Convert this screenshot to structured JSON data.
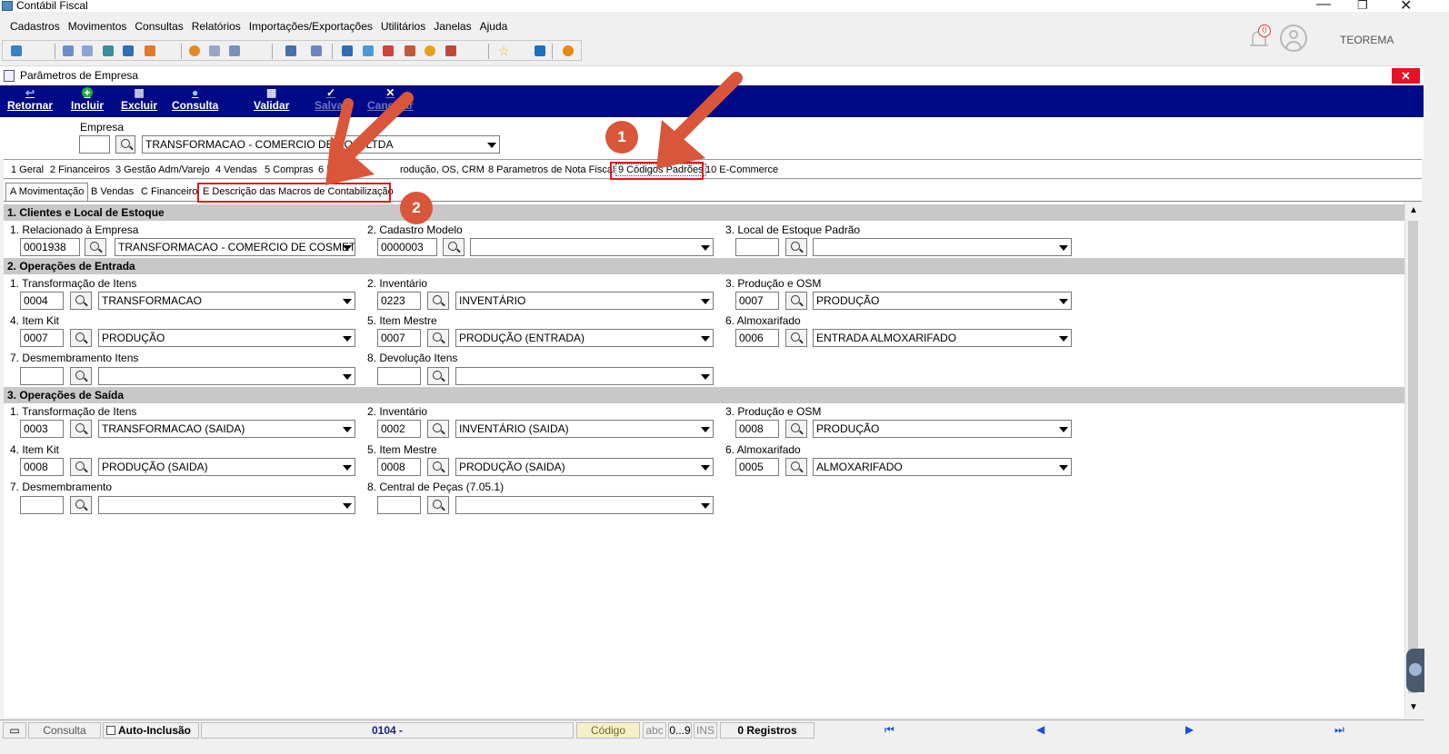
{
  "app": {
    "title": "Contábil Fiscal",
    "user": "TEOREMA",
    "notifications": "0"
  },
  "menu": [
    "Cadastros",
    "Movimentos",
    "Consultas",
    "Relatórios",
    "Importações/Exportações",
    "Utilitários",
    "Janelas",
    "Ajuda"
  ],
  "window": {
    "title": "Parâmetros de Empresa"
  },
  "actions": {
    "retornar": "Retornar",
    "incluir": "Incluir",
    "excluir": "Excluir",
    "consulta": "Consulta",
    "validar": "Validar",
    "salvar": "Salvar",
    "cancelar": "Cancelar"
  },
  "empresa": {
    "label": "Empresa",
    "code": "",
    "name": "TRANSFORMACAO - COMERCIO DE CO      S LTDA"
  },
  "tabs_main": [
    "1 Geral",
    "2 Financeiros",
    "3 Gestão Adm/Varejo",
    "4 Vendas",
    "5 Compras",
    "6 E",
    "rodução, OS, CRM",
    "8 Parametros de Nota Fiscal",
    "9 Códigos Padrões",
    "10 E-Commerce"
  ],
  "tabs_sub": [
    "A Movimentação",
    "B Vendas",
    "C Financeiro",
    "E Descrição das Macros de Contabilização"
  ],
  "sections": {
    "s1": "1.  Clientes e Local de Estoque",
    "s2": "2.  Operações de Entrada",
    "s3": "3.  Operações de Saída"
  },
  "fields": {
    "f1_1": {
      "label": "1. Relacionado à Empresa",
      "code": "0001938",
      "desc": "TRANSFORMACAO - COMERCIO DE COSMETI"
    },
    "f1_2": {
      "label": "2. Cadastro Modelo",
      "code": "0000003",
      "desc": ""
    },
    "f1_3": {
      "label": "3. Local de Estoque Padrão",
      "code": "",
      "desc": ""
    },
    "e1": {
      "label": "1. Transformação de Itens",
      "code": "0004",
      "desc": "TRANSFORMACAO"
    },
    "e2": {
      "label": "2. Inventário",
      "code": "0223",
      "desc": "INVENTÁRIO"
    },
    "e3": {
      "label": "3. Produção e OSM",
      "code": "0007",
      "desc": "PRODUÇÃO"
    },
    "e4": {
      "label": "4. Item Kit",
      "code": "0007",
      "desc": "PRODUÇÃO"
    },
    "e5": {
      "label": "5. Item Mestre",
      "code": "0007",
      "desc": "PRODUÇÃO (ENTRADA)"
    },
    "e6": {
      "label": "6. Almoxarifado",
      "code": "0006",
      "desc": "ENTRADA ALMOXARIFADO"
    },
    "e7": {
      "label": "7. Desmembramento Itens",
      "code": "",
      "desc": ""
    },
    "e8": {
      "label": "8. Devolução Itens",
      "code": "",
      "desc": ""
    },
    "s1": {
      "label": "1. Transformação de Itens",
      "code": "0003",
      "desc": "TRANSFORMACAO (SAIDA)"
    },
    "s2": {
      "label": "2. Inventário",
      "code": "0002",
      "desc": "INVENTÁRIO (SAIDA)"
    },
    "s3": {
      "label": "3. Produção e OSM",
      "code": "0008",
      "desc": "PRODUÇÃO"
    },
    "s4": {
      "label": "4. Item Kit",
      "code": "0008",
      "desc": "PRODUÇÃO (SAIDA)"
    },
    "s5": {
      "label": "5. Item Mestre",
      "code": "0008",
      "desc": "PRODUÇÃO (SAIDA)"
    },
    "s6": {
      "label": "6. Almoxarifado",
      "code": "0005",
      "desc": "ALMOXARIFADO"
    },
    "s7": {
      "label": "7. Desmembramento",
      "code": "",
      "desc": ""
    },
    "s8": {
      "label": "8. Central de Peças (7.05.1)",
      "code": "",
      "desc": ""
    }
  },
  "status": {
    "mode": "Consulta",
    "auto": "Auto-Inclusão",
    "code": "0104 -",
    "field": "Código",
    "abc": "abc",
    "num": "0...9",
    "ins": "INS",
    "registros": "0 Registros"
  },
  "annotations": {
    "badge1": "1",
    "badge2": "2"
  },
  "colors": {
    "action_bar": "#000a87",
    "section_header": "#c8c8c8",
    "highlight": "#e0141e",
    "badge": "#d9563a"
  }
}
